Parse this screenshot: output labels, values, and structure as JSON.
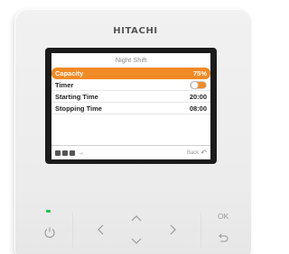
{
  "device": {
    "brand": "HITACHI"
  },
  "screen": {
    "title": "Night Shift",
    "rows": [
      {
        "label": "Capacity",
        "value": "75%"
      },
      {
        "label": "Timer",
        "value": ""
      },
      {
        "label": "Starting Time",
        "value": "20:00"
      },
      {
        "label": "Stopping Time",
        "value": "08:00"
      }
    ],
    "timer_on": true,
    "footer": {
      "back_label": "Back"
    }
  },
  "keys": {
    "ok_label": "OK"
  },
  "colors": {
    "accent": "#f08a24",
    "led": "#26c245"
  }
}
